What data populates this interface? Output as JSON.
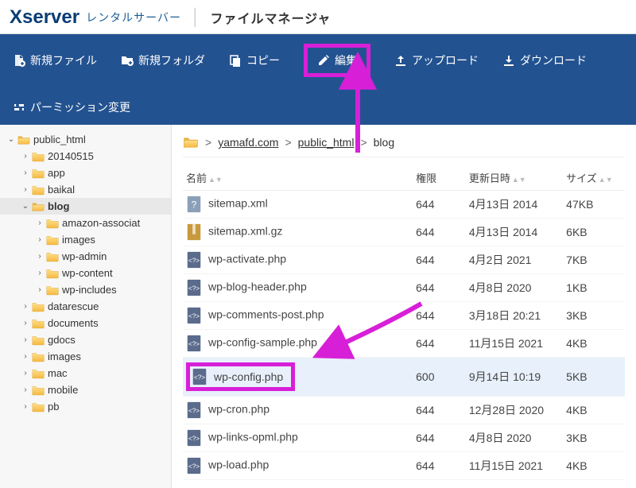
{
  "header": {
    "logo_main": "Xserver",
    "logo_sub": "レンタルサーバー",
    "title": "ファイルマネージャ"
  },
  "toolbar": {
    "new_file": "新規ファイル",
    "new_folder": "新規フォルダ",
    "copy": "コピー",
    "edit": "編集",
    "upload": "アップロード",
    "download": "ダウンロード",
    "permission": "パーミッション変更"
  },
  "tree": [
    {
      "label": "public_html",
      "depth": 0,
      "open": true,
      "selected": false
    },
    {
      "label": "20140515",
      "depth": 1,
      "open": false,
      "selected": false
    },
    {
      "label": "app",
      "depth": 1,
      "open": false,
      "selected": false
    },
    {
      "label": "baikal",
      "depth": 1,
      "open": false,
      "selected": false
    },
    {
      "label": "blog",
      "depth": 1,
      "open": true,
      "selected": true
    },
    {
      "label": "amazon-associat",
      "depth": 2,
      "open": false,
      "selected": false
    },
    {
      "label": "images",
      "depth": 2,
      "open": false,
      "selected": false
    },
    {
      "label": "wp-admin",
      "depth": 2,
      "open": false,
      "selected": false
    },
    {
      "label": "wp-content",
      "depth": 2,
      "open": false,
      "selected": false
    },
    {
      "label": "wp-includes",
      "depth": 2,
      "open": false,
      "selected": false
    },
    {
      "label": "datarescue",
      "depth": 1,
      "open": false,
      "selected": false
    },
    {
      "label": "documents",
      "depth": 1,
      "open": false,
      "selected": false
    },
    {
      "label": "gdocs",
      "depth": 1,
      "open": false,
      "selected": false
    },
    {
      "label": "images",
      "depth": 1,
      "open": false,
      "selected": false
    },
    {
      "label": "mac",
      "depth": 1,
      "open": false,
      "selected": false
    },
    {
      "label": "mobile",
      "depth": 1,
      "open": false,
      "selected": false
    },
    {
      "label": "pb",
      "depth": 1,
      "open": false,
      "selected": false
    }
  ],
  "breadcrumb": [
    "yamafd.com",
    "public_html",
    "blog"
  ],
  "columns": {
    "name": "名前",
    "perm": "権限",
    "date": "更新日時",
    "size": "サイズ"
  },
  "files": [
    {
      "name": "sitemap.xml",
      "icon": "unknown",
      "perm": "644",
      "date": "4月13日 2014",
      "size": "47KB",
      "selected": false,
      "hl": false
    },
    {
      "name": "sitemap.xml.gz",
      "icon": "archive",
      "perm": "644",
      "date": "4月13日 2014",
      "size": "6KB",
      "selected": false,
      "hl": false
    },
    {
      "name": "wp-activate.php",
      "icon": "php",
      "perm": "644",
      "date": "4月2日 2021",
      "size": "7KB",
      "selected": false,
      "hl": false
    },
    {
      "name": "wp-blog-header.php",
      "icon": "php",
      "perm": "644",
      "date": "4月8日 2020",
      "size": "1KB",
      "selected": false,
      "hl": false
    },
    {
      "name": "wp-comments-post.php",
      "icon": "php",
      "perm": "644",
      "date": "3月18日 20:21",
      "size": "3KB",
      "selected": false,
      "hl": false
    },
    {
      "name": "wp-config-sample.php",
      "icon": "php",
      "perm": "644",
      "date": "11月15日 2021",
      "size": "4KB",
      "selected": false,
      "hl": false
    },
    {
      "name": "wp-config.php",
      "icon": "php",
      "perm": "600",
      "date": "9月14日 10:19",
      "size": "5KB",
      "selected": true,
      "hl": true
    },
    {
      "name": "wp-cron.php",
      "icon": "php",
      "perm": "644",
      "date": "12月28日 2020",
      "size": "4KB",
      "selected": false,
      "hl": false
    },
    {
      "name": "wp-links-opml.php",
      "icon": "php",
      "perm": "644",
      "date": "4月8日 2020",
      "size": "3KB",
      "selected": false,
      "hl": false
    },
    {
      "name": "wp-load.php",
      "icon": "php",
      "perm": "644",
      "date": "11月15日 2021",
      "size": "4KB",
      "selected": false,
      "hl": false
    }
  ],
  "colors": {
    "accent": "#235290",
    "highlight": "#d81fd8"
  }
}
